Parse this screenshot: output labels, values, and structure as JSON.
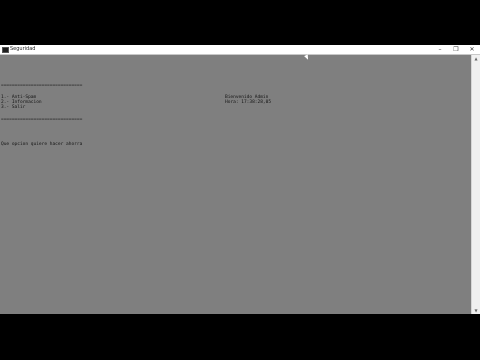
{
  "window": {
    "title": "Seguridad",
    "minimize_glyph": "–",
    "maximize_glyph": "❐",
    "close_glyph": "✕"
  },
  "console": {
    "separator_top": "==============================",
    "menu_1": "1.- Anti-Spam",
    "menu_2": "2.- Informacion",
    "menu_3": "3.- Salir",
    "welcome": "Bienvenido Admin",
    "time": "Hora: 17:38:28,05",
    "separator_bottom": "==============================",
    "prompt": "Que opcion quiere hacer ahorra"
  },
  "scrollbar": {
    "up_glyph": "▲",
    "down_glyph": "▼"
  },
  "colors": {
    "console_bg": "#7f7f7f",
    "text": "#111111",
    "titlebar_bg": "#ffffff"
  }
}
